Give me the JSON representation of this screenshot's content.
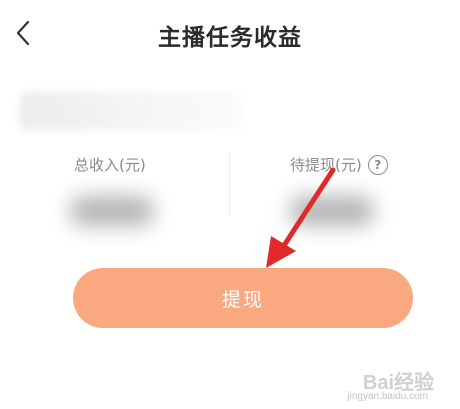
{
  "header": {
    "title": "主播任务收益",
    "back_icon": "chevron-left-icon"
  },
  "stats": {
    "total_income_label": "总收入(元)",
    "pending_withdraw_label": "待提现(元)",
    "help_icon": "question-circle-icon",
    "help_glyph": "?"
  },
  "cashout": {
    "label": "提现",
    "color": "#f9a87f"
  },
  "annotation": {
    "arrow_color": "#e02a2a"
  },
  "watermark": {
    "text": "Bai经验",
    "sub_text": "jingyan.baidu.com"
  }
}
